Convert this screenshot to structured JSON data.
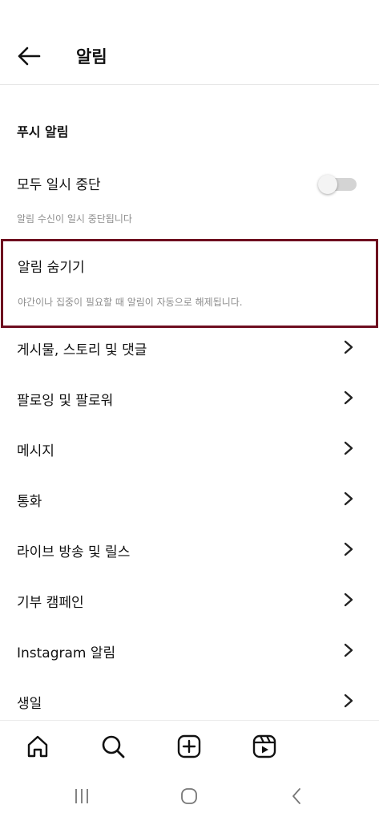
{
  "header": {
    "title": "알림",
    "back_icon": "arrow-left-icon"
  },
  "section": {
    "title": "푸시 알림"
  },
  "pause_all": {
    "label": "모두 일시 중단",
    "enabled": false,
    "description": "알림 수신이 일시 중단됩니다"
  },
  "hide_notifications": {
    "label": "알림 숨기기",
    "description": "야간이나 집중이 필요할 때 알림이 자동으로 해제됩니다.",
    "highlight_color": "#6e0d1f"
  },
  "menu_items": [
    {
      "label": "게시물, 스토리 및 댓글"
    },
    {
      "label": "팔로잉 및 팔로워"
    },
    {
      "label": "메시지"
    },
    {
      "label": "통화"
    },
    {
      "label": "라이브 방송 및 릴스"
    },
    {
      "label": "기부 캠페인"
    },
    {
      "label": "Instagram 알림"
    },
    {
      "label": "생일"
    }
  ],
  "bottom_nav": {
    "tabs": [
      {
        "icon": "home-icon"
      },
      {
        "icon": "search-icon"
      },
      {
        "icon": "create-post-icon"
      },
      {
        "icon": "reels-icon"
      }
    ]
  },
  "system_nav": {
    "buttons": [
      {
        "icon": "recent-apps-icon"
      },
      {
        "icon": "home-circle-icon"
      },
      {
        "icon": "back-chevron-icon"
      }
    ]
  }
}
